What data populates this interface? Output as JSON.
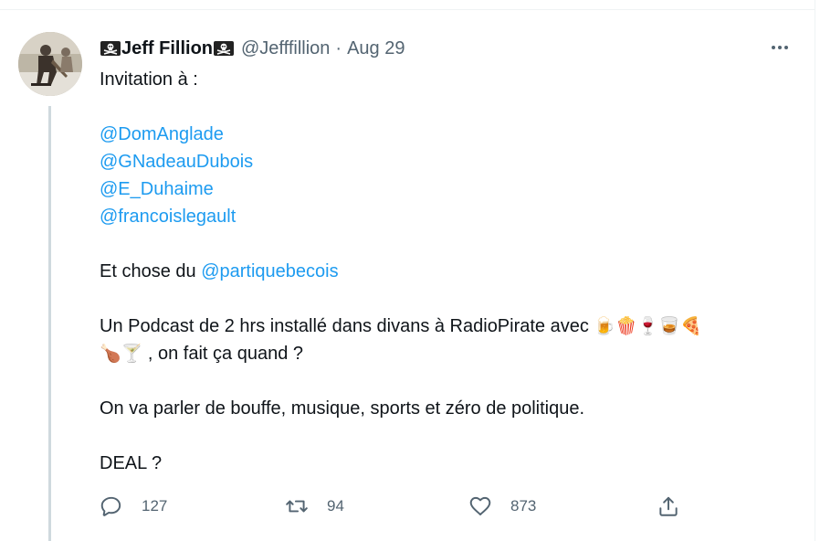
{
  "tweet": {
    "display_name": "Jeff Fillion",
    "handle": "@Jefffillion",
    "separator": "·",
    "date": "Aug 29",
    "lines": [
      [
        {
          "t": "Invitation à :"
        }
      ],
      [],
      [
        {
          "t": "@DomAnglade",
          "m": true
        }
      ],
      [
        {
          "t": "@GNadeauDubois",
          "m": true
        }
      ],
      [
        {
          "t": "@E_Duhaime",
          "m": true
        }
      ],
      [
        {
          "t": "@francoislegault",
          "m": true
        }
      ],
      [],
      [
        {
          "t": "Et chose du "
        },
        {
          "t": "@partiquebecois",
          "m": true
        }
      ],
      [],
      [
        {
          "t": "Un Podcast de 2 hrs installé dans divans à RadioPirate avec "
        },
        {
          "t": "🍺🍿🍷🥃🍕",
          "e": true
        }
      ],
      [
        {
          "t": "🍗🍸",
          "e": true
        },
        {
          "t": " , on fait ça quand ?"
        }
      ],
      [],
      [
        {
          "t": "On va parler de bouffe, musique, sports et zéro de politique."
        }
      ],
      [],
      [
        {
          "t": "DEAL ?"
        }
      ]
    ]
  },
  "icons": {
    "name_flag": "pirate-flag-icon",
    "more": "more-options-icon",
    "reply": "reply-icon",
    "retweet": "retweet-icon",
    "like": "heart-icon",
    "share": "share-icon"
  },
  "actions": {
    "reply_count": "127",
    "retweet_count": "94",
    "like_count": "873"
  },
  "colors": {
    "link": "#1d9bf0",
    "secondary": "#536471",
    "text": "#0f1419",
    "thread_line": "#cfd9de"
  }
}
